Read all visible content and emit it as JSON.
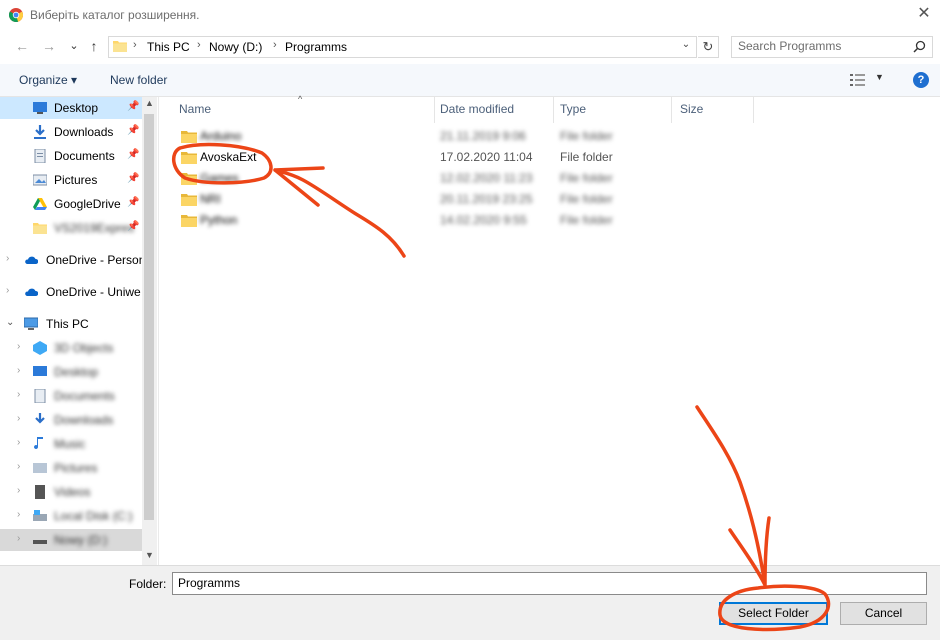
{
  "window": {
    "title": "Виберіть каталог розширення.",
    "close_glyph": "✕"
  },
  "nav": {
    "back": "←",
    "forward": "→",
    "recent": "⌄",
    "up": "↑",
    "breadcrumbs": [
      "This PC",
      "Nowy (D:)",
      "Programms"
    ],
    "refresh": "↻",
    "dropdown": "⌄",
    "search_placeholder": "Search Programms"
  },
  "toolbar": {
    "organize": "Organize ▾",
    "new_folder": "New folder",
    "help": "?",
    "view_drop": "▼"
  },
  "nav_pane": {
    "quick_access": [
      {
        "label": "Desktop",
        "icon": "desktop-icon"
      },
      {
        "label": "Downloads",
        "icon": "download-icon"
      },
      {
        "label": "Documents",
        "icon": "documents-icon"
      },
      {
        "label": "Pictures",
        "icon": "pictures-icon"
      },
      {
        "label": "GoogleDrive",
        "icon": "google-drive-icon"
      },
      {
        "label": "VS2019Expres",
        "icon": "folder-icon"
      }
    ],
    "onedrive_personal": "OneDrive - Person",
    "onedrive_uni": "OneDrive - Uniwe",
    "this_pc": "This PC",
    "pc_children": [
      {
        "label": "3D Objects",
        "icon": "3d-objects-icon"
      },
      {
        "label": "Desktop",
        "icon": "desktop-icon"
      },
      {
        "label": "Documents",
        "icon": "documents-icon"
      },
      {
        "label": "Downloads",
        "icon": "download-icon"
      },
      {
        "label": "Music",
        "icon": "music-icon"
      },
      {
        "label": "Pictures",
        "icon": "pictures-icon"
      },
      {
        "label": "Videos",
        "icon": "videos-icon"
      },
      {
        "label": "Local Disk (C:)",
        "icon": "local-disk-icon"
      },
      {
        "label": "Nowy (D:)",
        "icon": "drive-icon"
      }
    ]
  },
  "columns": {
    "name": "Name",
    "date": "Date modified",
    "type": "Type",
    "size": "Size"
  },
  "files": [
    {
      "name": "Arduino",
      "date": "21.11.2019 9:06",
      "type": "File folder",
      "blurred": true
    },
    {
      "name": "AvoskaExt",
      "date": "17.02.2020 11:04",
      "type": "File folder",
      "blurred": false
    },
    {
      "name": "Games",
      "date": "12.02.2020 11:23",
      "type": "File folder",
      "blurred": true
    },
    {
      "name": "NRI",
      "date": "20.11.2019 23:25",
      "type": "File folder",
      "blurred": true
    },
    {
      "name": "Python",
      "date": "14.02.2020 9:55",
      "type": "File folder",
      "blurred": true
    }
  ],
  "bottom": {
    "folder_label": "Folder:",
    "folder_value": "Programms",
    "select_button": "Select Folder",
    "cancel_button": "Cancel"
  },
  "colors": {
    "accent": "#0078d7",
    "annotation": "#ec4517"
  }
}
